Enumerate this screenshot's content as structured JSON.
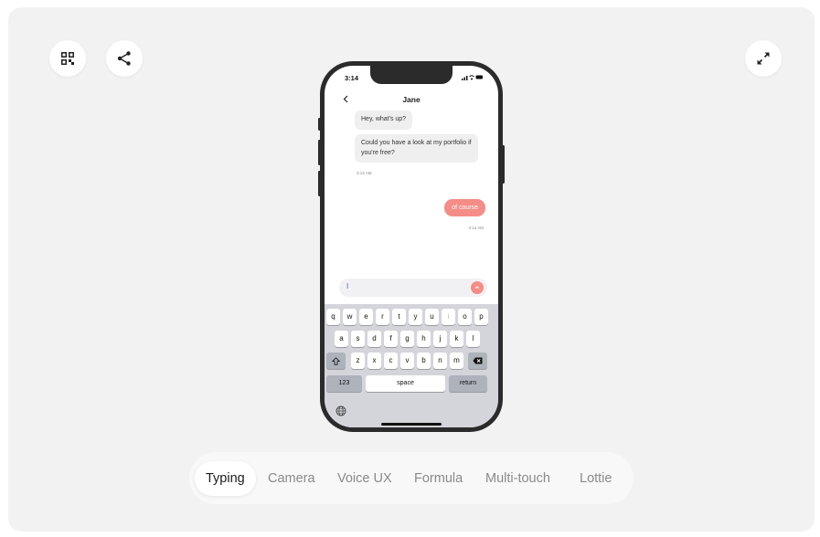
{
  "toolbar": {
    "qr_icon": "qr-code-icon",
    "share_icon": "share-icon",
    "expand_icon": "expand-icon"
  },
  "phone": {
    "status_time": "3:14",
    "status_icons": "signal-wifi-battery",
    "chat_title": "Jane",
    "back_icon": "chevron-left-icon",
    "messages": [
      {
        "from": "Jane",
        "text": "Hey, what's up?"
      },
      {
        "from": "Jane",
        "text": "Could you have a look at my portfolio if you're free?"
      },
      {
        "from": "me",
        "text": "of course"
      }
    ],
    "incoming_time": "3:13 AM",
    "outgoing_time": "3:14 AM",
    "input_value": "I",
    "send_icon": "arrow-up-icon"
  },
  "keyboard": {
    "row1": [
      "q",
      "w",
      "e",
      "r",
      "t",
      "y",
      "u",
      "i",
      "o",
      "p"
    ],
    "row2": [
      "a",
      "s",
      "d",
      "f",
      "g",
      "h",
      "j",
      "k",
      "l"
    ],
    "row3": [
      "z",
      "x",
      "c",
      "v",
      "b",
      "n",
      "m"
    ],
    "numbers_label": "123",
    "space_label": "space",
    "return_label": "return"
  },
  "tabs": [
    "Typing",
    "Camera",
    "Voice UX",
    "Formula",
    "Multi-touch",
    "Lottie"
  ],
  "active_tab": "Typing",
  "colors": {
    "accent": "#f48d87",
    "stage_bg": "#f2f2f2",
    "phone_frame": "#2b2b2b"
  }
}
